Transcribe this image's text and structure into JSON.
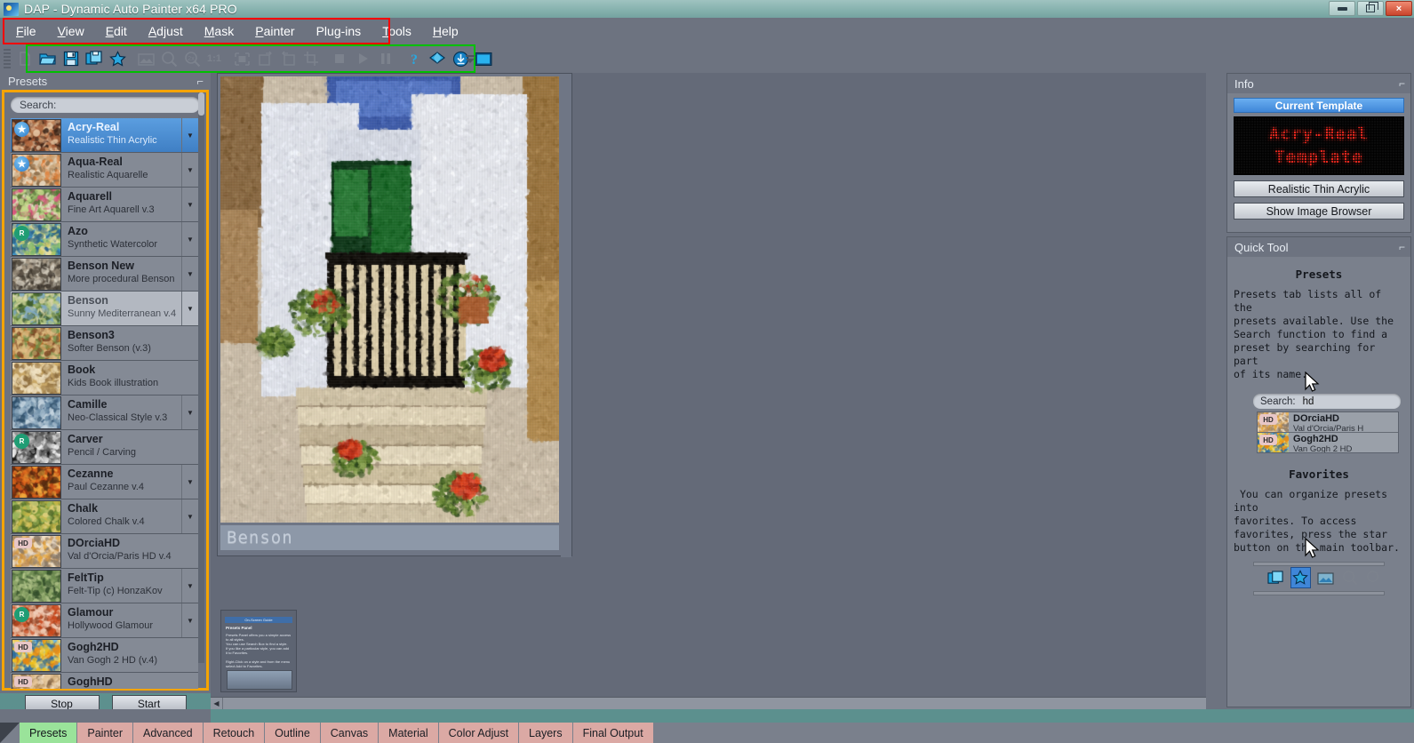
{
  "window": {
    "title": "DAP - Dynamic Auto Painter x64 PRO",
    "app_icon": "dap-app-icon",
    "buttons": {
      "minimize": "minimize",
      "maximize": "maximize",
      "close": "×"
    }
  },
  "menubar": {
    "highlight_color": "#ff0000",
    "items": [
      {
        "label": "File",
        "mnemonic": "F"
      },
      {
        "label": "View",
        "mnemonic": "V"
      },
      {
        "label": "Edit",
        "mnemonic": "E"
      },
      {
        "label": "Adjust",
        "mnemonic": "A"
      },
      {
        "label": "Mask",
        "mnemonic": "M"
      },
      {
        "label": "Painter",
        "mnemonic": "P"
      },
      {
        "label": "Plug-ins",
        "mnemonic": "g"
      },
      {
        "label": "Tools",
        "mnemonic": "T"
      },
      {
        "label": "Help",
        "mnemonic": "H"
      }
    ]
  },
  "toolbar": {
    "highlight_color": "#00c000",
    "buttons": [
      {
        "name": "new-icon",
        "enabled": false
      },
      {
        "name": "open-folder-icon",
        "enabled": true
      },
      {
        "name": "save-icon",
        "enabled": true
      },
      {
        "name": "save-as-icon",
        "enabled": true
      },
      {
        "name": "star-favorites-icon",
        "enabled": true
      },
      {
        "name": "image-browser-icon",
        "enabled": false
      },
      {
        "name": "zoom-out-icon",
        "enabled": false
      },
      {
        "name": "zoom-2x-icon",
        "enabled": false
      },
      {
        "name": "zoom-1to1-icon",
        "enabled": false,
        "label": "1:1"
      },
      {
        "name": "fit-to-screen-icon",
        "enabled": false
      },
      {
        "name": "rotate-left-icon",
        "enabled": false
      },
      {
        "name": "rotate-right-icon",
        "enabled": false
      },
      {
        "name": "crop-icon",
        "enabled": false
      },
      {
        "name": "stop-icon",
        "enabled": false
      },
      {
        "name": "play-icon",
        "enabled": false
      },
      {
        "name": "pause-icon",
        "enabled": false
      },
      {
        "name": "help-question-icon",
        "enabled": true
      },
      {
        "name": "gem-plugin-icon",
        "enabled": true
      },
      {
        "name": "download-icon",
        "enabled": true
      },
      {
        "name": "full-canvas-icon",
        "enabled": true
      }
    ],
    "overflow": "toolbar-overflow-chevron"
  },
  "presets_panel": {
    "caption": "Presets",
    "pin": "pin-icon",
    "highlight_color": "#f5a400",
    "search": {
      "label": "Search:",
      "value": "",
      "placeholder": ""
    },
    "items": [
      {
        "name": "Acry-Real",
        "desc": "Realistic Thin Acrylic",
        "badge": "star",
        "state": "selected",
        "arrow": true
      },
      {
        "name": "Aqua-Real",
        "desc": "Realistic Aquarelle",
        "badge": "star",
        "state": "normal",
        "arrow": true
      },
      {
        "name": "Aquarell",
        "desc": "Fine Art Aquarell v.3",
        "badge": "",
        "state": "normal",
        "arrow": true
      },
      {
        "name": "Azo",
        "desc": "Synthetic Watercolor",
        "badge": "R",
        "state": "normal",
        "arrow": true
      },
      {
        "name": "Benson New",
        "desc": "More procedural Benson",
        "badge": "",
        "state": "normal",
        "arrow": true
      },
      {
        "name": "Benson",
        "desc": "Sunny Mediterranean v.4",
        "badge": "",
        "state": "hover",
        "arrow": true
      },
      {
        "name": "Benson3",
        "desc": "Softer Benson (v.3)",
        "badge": "",
        "state": "normal",
        "arrow": false
      },
      {
        "name": "Book",
        "desc": "Kids Book illustration",
        "badge": "",
        "state": "normal",
        "arrow": false
      },
      {
        "name": "Camille",
        "desc": "Neo-Classical Style v.3",
        "badge": "",
        "state": "normal",
        "arrow": true
      },
      {
        "name": "Carver",
        "desc": "Pencil / Carving",
        "badge": "R",
        "state": "normal",
        "arrow": false
      },
      {
        "name": "Cezanne",
        "desc": "Paul Cezanne v.4",
        "badge": "",
        "state": "normal",
        "arrow": true
      },
      {
        "name": "Chalk",
        "desc": "Colored Chalk v.4",
        "badge": "",
        "state": "normal",
        "arrow": true
      },
      {
        "name": "DOrciaHD",
        "desc": "Val d'Orcia/Paris HD v.4",
        "badge": "HD",
        "state": "normal",
        "arrow": false
      },
      {
        "name": "FeltTip",
        "desc": "Felt-Tip (c) HonzaKov",
        "badge": "",
        "state": "normal",
        "arrow": true
      },
      {
        "name": "Glamour",
        "desc": "Hollywood Glamour",
        "badge": "R",
        "state": "normal",
        "arrow": true
      },
      {
        "name": "Gogh2HD",
        "desc": "Van Gogh 2 HD (v.4)",
        "badge": "HD",
        "state": "normal",
        "arrow": false
      },
      {
        "name": "GoghHD",
        "desc": "",
        "badge": "HD",
        "state": "normal",
        "arrow": false
      }
    ],
    "stop_label": "Stop",
    "start_label": "Start"
  },
  "canvas": {
    "document_caption": "Benson",
    "guide_thumbnail": {
      "title": "On-Screen Guide",
      "heading": "Presets Panel",
      "body": "Presets Panel offers you a simple access to all styles.\nYou can use Search Box to find a style.\nIf you like a particular style, you can add it to Favorites.\n\nRight-Click on a style and from the menu select Add to Favorites."
    }
  },
  "info_panel": {
    "caption": "Info",
    "pin": "pin-icon",
    "current_template_label": "Current Template",
    "led_line1": "Acry-Real",
    "led_line2": "Template",
    "led_color": "#e8281e",
    "template_desc_button": "Realistic Thin Acrylic",
    "image_browser_button": "Show Image Browser"
  },
  "quick_tool_panel": {
    "caption": "Quick Tool",
    "pin": "pin-icon",
    "presets_heading": "Presets",
    "presets_body": "Presets tab lists all of the\npresets available. Use the\nSearch function to find a\npreset by searching for part\nof its name.",
    "search": {
      "label": "Search:",
      "value": "hd"
    },
    "results": [
      {
        "name": "DOrciaHD",
        "desc": "Val d'Orcia/Paris H",
        "badge": "HD"
      },
      {
        "name": "Gogh2HD",
        "desc": "Van Gogh 2 HD",
        "badge": "HD"
      }
    ],
    "favorites_heading": "Favorites",
    "favorites_body": " You can organize presets into\nfavorites. To access\nfavorites, press the star\nbutton on the main toolbar.",
    "mini_toolbar": [
      {
        "name": "save-as-icon",
        "active": false
      },
      {
        "name": "star-favorites-icon",
        "active": true
      },
      {
        "name": "image-browser-icon",
        "active": false
      },
      {
        "name": "zoom-out-icon",
        "active": false
      },
      {
        "name": "zoom-2x-icon",
        "active": false
      }
    ]
  },
  "tabbar": {
    "tabs": [
      {
        "label": "Presets",
        "active": true
      },
      {
        "label": "Painter",
        "active": false
      },
      {
        "label": "Advanced",
        "active": false
      },
      {
        "label": "Retouch",
        "active": false
      },
      {
        "label": "Outline",
        "active": false
      },
      {
        "label": "Canvas",
        "active": false
      },
      {
        "label": "Material",
        "active": false
      },
      {
        "label": "Color Adjust",
        "active": false
      },
      {
        "label": "Layers",
        "active": false
      },
      {
        "label": "Final Output",
        "active": false
      }
    ]
  }
}
